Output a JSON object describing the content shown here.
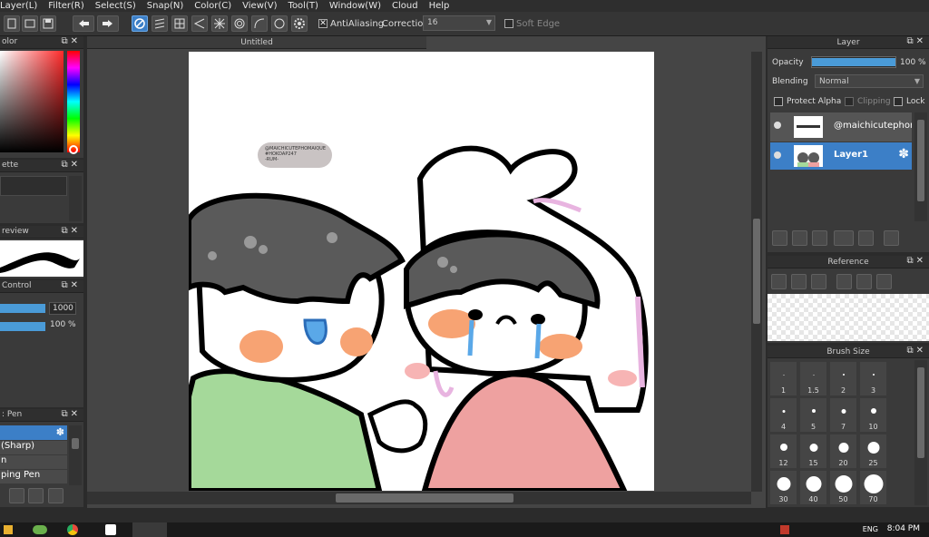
{
  "menu": {
    "items": [
      "Layer(L)",
      "Filter(R)",
      "Select(S)",
      "Snap(N)",
      "Color(C)",
      "View(V)",
      "Tool(T)",
      "Window(W)",
      "Cloud",
      "Help"
    ]
  },
  "toolbar": {
    "antialiasing_label": "AntiAliasing",
    "correction_label": "Correction",
    "correction_value": "16",
    "soft_edge_label": "Soft Edge"
  },
  "left": {
    "color_title": "olor",
    "palette_title": "ette",
    "preview_title": "review",
    "control_title": "Control",
    "control_size": "1000",
    "control_opacity": "100 %",
    "brush_title": ": Pen",
    "brush_items": [
      "(Sharp)",
      "n",
      "ping Pen"
    ]
  },
  "document": {
    "tab_title": "Untitled",
    "watermark_line1": "@MAICHICUTEPHOMAIQUE",
    "watermark_line2": "#HOKDAP247",
    "watermark_line3": "-RUM-"
  },
  "layer_panel": {
    "title": "Layer",
    "opacity_label": "Opacity",
    "opacity_value": "100 %",
    "opacity_fraction": 1.0,
    "blending_label": "Blending",
    "blending_value": "Normal",
    "protect_alpha_label": "Protect Alpha",
    "clipping_label": "Clipping",
    "lock_label": "Lock",
    "layers": [
      {
        "name": "@maichicutephom"
      },
      {
        "name": "Layer1"
      }
    ]
  },
  "reference_panel": {
    "title": "Reference"
  },
  "brush_size_panel": {
    "title": "Brush Size",
    "sizes": [
      "1",
      "1.5",
      "2",
      "3",
      "4",
      "5",
      "7",
      "10",
      "12",
      "15",
      "20",
      "25",
      "30",
      "40",
      "50",
      "70"
    ]
  },
  "taskbar": {
    "lang": "ENG",
    "time": "8:04 PM"
  },
  "colors": {
    "accent": "#3c7fc7",
    "skin": "#ffffff",
    "hair": "#5a5a5a",
    "blush": "#f7a373",
    "green_shirt": "#a5d99a",
    "pink_shirt": "#eea1a0",
    "tears": "#5aa8e8"
  }
}
